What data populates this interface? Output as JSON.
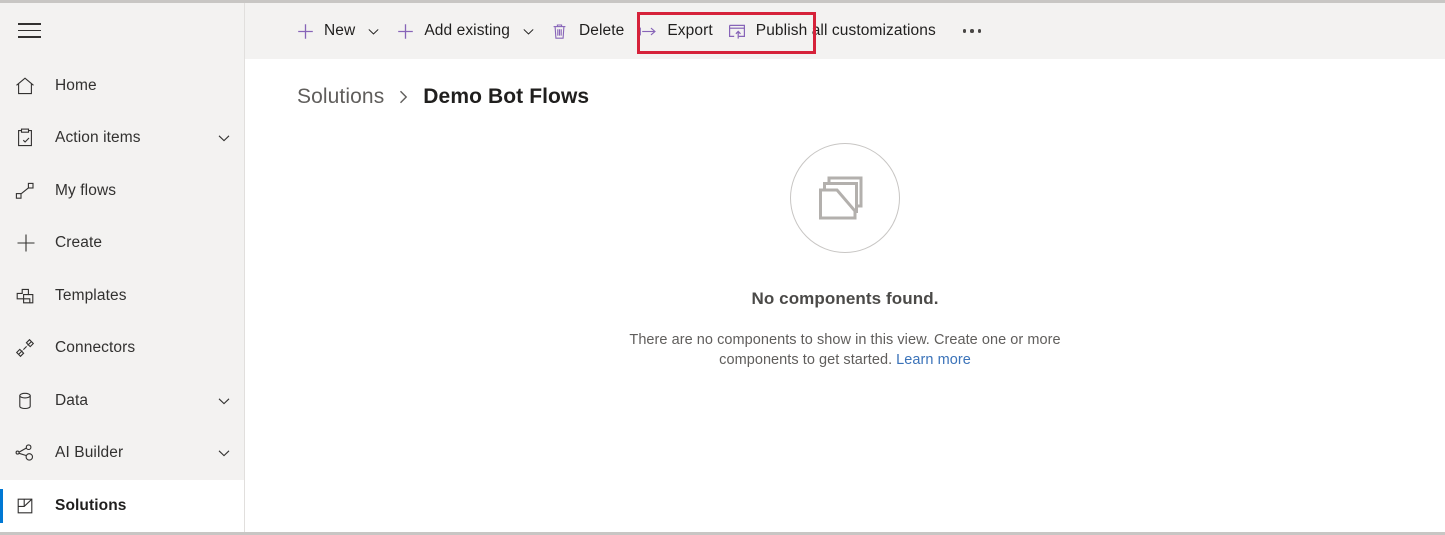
{
  "sidebar": {
    "menu_button": "menu-hamburger",
    "items": [
      {
        "label": "Home",
        "icon": "home-icon",
        "expandable": false,
        "selected": false
      },
      {
        "label": "Action items",
        "icon": "clipboard-check-icon",
        "expandable": true,
        "selected": false
      },
      {
        "label": "My flows",
        "icon": "flow-icon",
        "expandable": false,
        "selected": false
      },
      {
        "label": "Create",
        "icon": "plus-icon",
        "expandable": false,
        "selected": false
      },
      {
        "label": "Templates",
        "icon": "templates-icon",
        "expandable": false,
        "selected": false
      },
      {
        "label": "Connectors",
        "icon": "connectors-icon",
        "expandable": false,
        "selected": false
      },
      {
        "label": "Data",
        "icon": "database-icon",
        "expandable": true,
        "selected": false
      },
      {
        "label": "AI Builder",
        "icon": "ai-builder-icon",
        "expandable": true,
        "selected": false
      },
      {
        "label": "Solutions",
        "icon": "solutions-icon",
        "expandable": false,
        "selected": true
      }
    ]
  },
  "command_bar": {
    "commands": [
      {
        "label": "New",
        "icon": "plus-icon",
        "has_chevron": true
      },
      {
        "label": "Add existing",
        "icon": "plus-icon",
        "has_chevron": true
      },
      {
        "label": "Delete",
        "icon": "trash-icon",
        "has_chevron": false
      },
      {
        "label": "Export",
        "icon": "export-icon",
        "has_chevron": false
      },
      {
        "label": "Publish all customizations",
        "icon": "publish-icon",
        "has_chevron": false
      }
    ],
    "overflow_label": "More commands",
    "highlighted_command": "Add existing",
    "highlight_color": "#d6223a",
    "icon_color": "#8764b8"
  },
  "breadcrumb": {
    "parent": "Solutions",
    "separator": "›",
    "current": "Demo Bot Flows"
  },
  "empty_state": {
    "illustration": "empty-document-icon",
    "title": "No components found.",
    "description": "There are no components to show in this view. Create one or more components to get started.",
    "link_text": "Learn more",
    "link_color": "#3b73b9"
  }
}
